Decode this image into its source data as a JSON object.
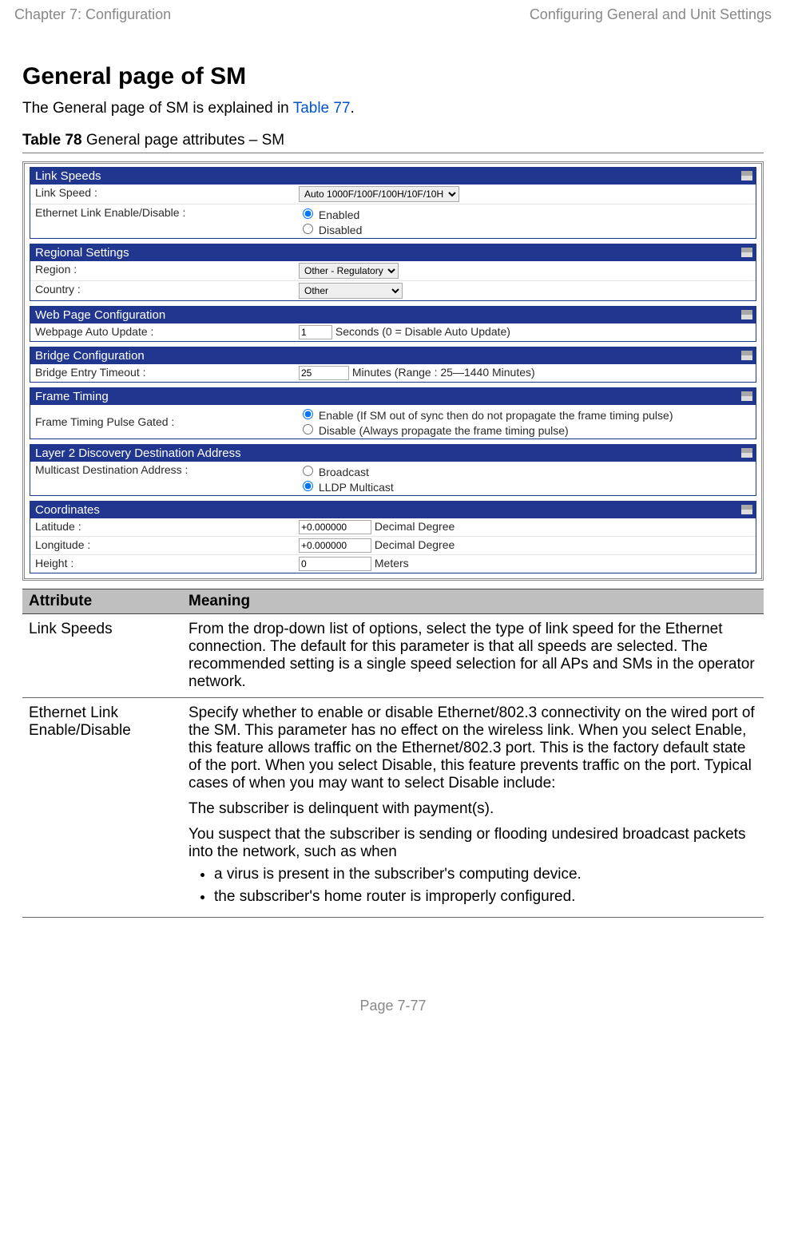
{
  "header": {
    "left": "Chapter 7:  Configuration",
    "right": "Configuring General and Unit Settings"
  },
  "title": "General page of SM",
  "intro_prefix": "The General page of SM is explained in ",
  "intro_link": "Table 77",
  "intro_suffix": ".",
  "table_caption_bold": "Table 78",
  "table_caption_rest": " General page attributes – SM",
  "panels": {
    "link_speeds": {
      "title": "Link Speeds",
      "row1_label": "Link Speed :",
      "row1_value": "Auto 1000F/100F/100H/10F/10H",
      "row2_label": "Ethernet Link Enable/Disable :",
      "row2_opt1": "Enabled",
      "row2_opt2": "Disabled"
    },
    "regional": {
      "title": "Regional Settings",
      "row1_label": "Region :",
      "row1_value": "Other - Regulatory",
      "row2_label": "Country :",
      "row2_value": "Other"
    },
    "webpage": {
      "title": "Web Page Configuration",
      "row1_label": "Webpage Auto Update :",
      "row1_value": "1",
      "row1_suffix": "Seconds (0 = Disable Auto Update)"
    },
    "bridge": {
      "title": "Bridge Configuration",
      "row1_label": "Bridge Entry Timeout :",
      "row1_value": "25",
      "row1_suffix": "Minutes (Range : 25—1440 Minutes)"
    },
    "frame": {
      "title": "Frame Timing",
      "row1_label": "Frame Timing Pulse Gated :",
      "opt1": "Enable (If SM out of sync then do not propagate the frame timing pulse)",
      "opt2": "Disable (Always propagate the frame timing pulse)"
    },
    "layer2": {
      "title": "Layer 2 Discovery Destination Address",
      "row1_label": "Multicast Destination Address :",
      "opt1": "Broadcast",
      "opt2": "LLDP Multicast"
    },
    "coords": {
      "title": "Coordinates",
      "lat_label": "Latitude :",
      "lat_value": "+0.000000",
      "lat_suffix": "Decimal Degree",
      "lon_label": "Longitude :",
      "lon_value": "+0.000000",
      "lon_suffix": "Decimal Degree",
      "hgt_label": "Height :",
      "hgt_value": "0",
      "hgt_suffix": "Meters"
    }
  },
  "attr_table": {
    "head_attr": "Attribute",
    "head_mean": "Meaning",
    "rows": [
      {
        "attr": "Link Speeds",
        "meaning_p1": "From the drop-down list of options, select the type of link speed for the Ethernet connection. The default for this parameter is that all speeds are selected. The recommended setting is a single speed selection for all APs and SMs in the operator network."
      },
      {
        "attr": "Ethernet Link Enable/Disable",
        "p1_pre": "Specify whether to enable or disable Ethernet/802.3 connectivity on the wired port of the SM. This parameter has no effect on the wireless link. When you select ",
        "p1_b1": "Enable",
        "p1_mid1": ", this feature allows traffic on the Ethernet/802.3 port. This is the factory default state of the port. When you select ",
        "p1_b2": "Disable",
        "p1_mid2": ", this feature prevents traffic on the port. Typical cases of when you may want to select ",
        "p1_b3": "Disable",
        "p1_post": " include:",
        "p2": "The subscriber is delinquent with payment(s).",
        "p3": "You suspect that the subscriber is sending or flooding undesired broadcast packets into the network, such as when",
        "bul1": "a virus is present in the subscriber's computing device.",
        "bul2": "the subscriber's home router is improperly configured."
      }
    ]
  },
  "footer": "Page 7-77"
}
